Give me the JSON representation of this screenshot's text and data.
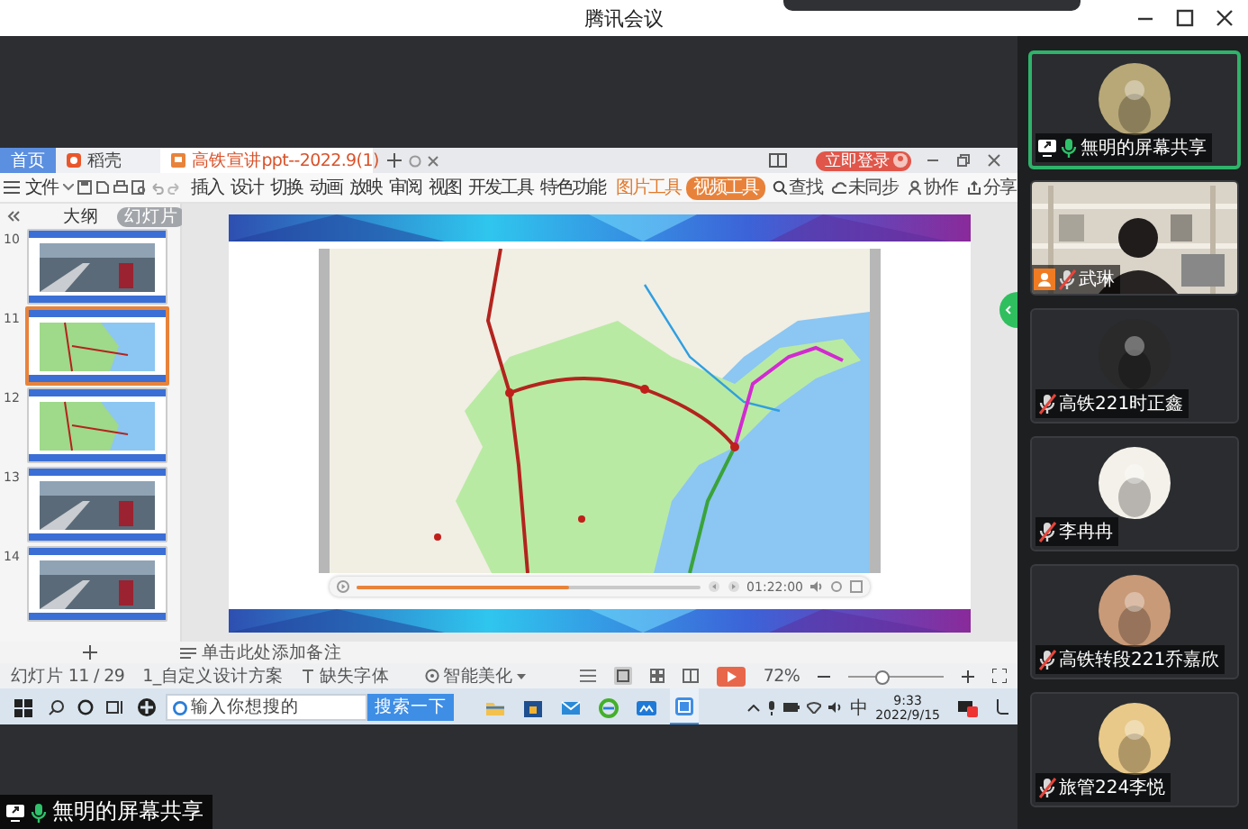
{
  "window": {
    "title": "腾讯会议"
  },
  "share": {
    "tabs": [
      {
        "label": "首页",
        "kind": "home",
        "selected": false
      },
      {
        "label": "稻壳",
        "kind": "docer",
        "selected": false
      },
      {
        "label": "高铁宣讲ppt--2022.9(1)",
        "kind": "document",
        "selected": true
      }
    ],
    "login_button": "立即登录",
    "file_menu": "文件",
    "ribbon": [
      {
        "label": "插入",
        "kind": "tab",
        "selected": false
      },
      {
        "label": "设计",
        "kind": "tab",
        "selected": false
      },
      {
        "label": "切换",
        "kind": "tab",
        "selected": false
      },
      {
        "label": "动画",
        "kind": "tab",
        "selected": false
      },
      {
        "label": "放映",
        "kind": "tab",
        "selected": false
      },
      {
        "label": "审阅",
        "kind": "tab",
        "selected": false
      },
      {
        "label": "视图",
        "kind": "tab",
        "selected": false
      },
      {
        "label": "开发工具",
        "kind": "tab",
        "selected": false
      },
      {
        "label": "特色功能",
        "kind": "tab",
        "selected": false
      },
      {
        "label": "图片工具",
        "kind": "context",
        "selected": false
      },
      {
        "label": "视频工具",
        "kind": "context",
        "selected": true
      }
    ],
    "actions": [
      {
        "label": "查找",
        "kind": "search"
      },
      {
        "label": "未同步",
        "kind": "cloud"
      },
      {
        "label": "协作",
        "kind": "people"
      },
      {
        "label": "分享",
        "kind": "share"
      }
    ],
    "panel_tabs": [
      {
        "label": "大纲",
        "selected": false
      },
      {
        "label": "幻灯片",
        "selected": true
      }
    ],
    "slides": [
      {
        "number": "10",
        "selected": false
      },
      {
        "number": "11",
        "kind": "map",
        "selected": true
      },
      {
        "number": "12",
        "kind": "map",
        "selected": false
      },
      {
        "number": "13",
        "selected": false
      },
      {
        "number": "14",
        "selected": false
      }
    ],
    "player": {
      "level": 0.62,
      "time": "01:22:00"
    },
    "notes_placeholder": "单击此处添加备注",
    "status": {
      "slide_count": "幻灯片 11 / 29",
      "theme": "1_自定义设计方案",
      "missing_fonts": "缺失字体",
      "beautify": "智能美化",
      "zoom": "72%"
    },
    "zoom_slider": {
      "level": 0.35
    },
    "taskbar": {
      "search_placeholder": "输入你想搜的",
      "search_button": "搜索一下",
      "input_method": "中",
      "time": "9:33",
      "date": "2022/9/15"
    }
  },
  "share_label": {
    "name": "無明的屏幕共享",
    "muted": false
  },
  "participants": [
    {
      "name": "無明的屏幕共享",
      "kind": "avatar",
      "color": "#b8a878",
      "muted": false,
      "sharing": true,
      "speaking": true,
      "host": false
    },
    {
      "name": "武琳",
      "kind": "video",
      "muted": true,
      "sharing": false,
      "speaking": false,
      "host": true
    },
    {
      "name": "高铁221时正鑫",
      "kind": "avatar",
      "color": "#2a2a2a",
      "muted": true,
      "sharing": false,
      "speaking": false,
      "host": false
    },
    {
      "name": "李冉冉",
      "kind": "avatar",
      "color": "#f4f1ea",
      "muted": true,
      "sharing": false,
      "speaking": false,
      "host": false
    },
    {
      "name": "高铁转段221乔嘉欣",
      "kind": "avatar",
      "color": "#c89a78",
      "muted": true,
      "sharing": false,
      "speaking": false,
      "host": false
    },
    {
      "name": "旅管224李悦",
      "kind": "avatar",
      "color": "#e8c98a",
      "muted": true,
      "sharing": false,
      "speaking": false,
      "host": false
    }
  ]
}
